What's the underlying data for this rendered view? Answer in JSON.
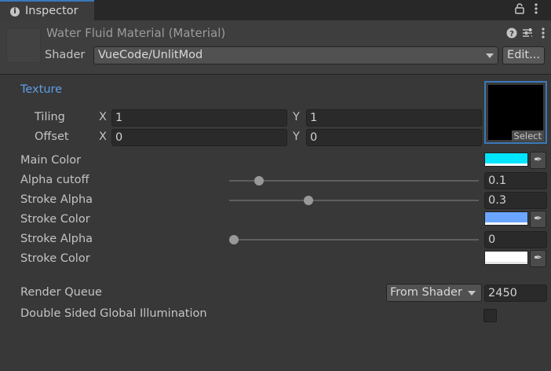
{
  "tab": {
    "icon": "info-icon",
    "label": "Inspector"
  },
  "tab_actions": {
    "lock_icon": "lock-icon",
    "menu_icon": "kebab-menu-icon"
  },
  "header": {
    "title": "Water Fluid Material (Material)",
    "help_icon": "help-icon",
    "settings_icon": "preset-settings-icon",
    "menu_icon": "kebab-menu-icon",
    "shader_label": "Shader",
    "shader_value": "VueCode/UnlitMod",
    "edit_button": "Edit..."
  },
  "texture": {
    "label": "Texture",
    "tiling_label": "Tiling",
    "offset_label": "Offset",
    "x_label": "X",
    "y_label": "Y",
    "tiling_x": "1",
    "tiling_y": "1",
    "offset_x": "0",
    "offset_y": "0",
    "select_label": "Select"
  },
  "properties": {
    "main_color": {
      "label": "Main Color",
      "color": "#00e6ff"
    },
    "alpha_cutoff": {
      "label": "Alpha cutoff",
      "value": "0.1",
      "fraction": 0.1
    },
    "stroke_alpha_1": {
      "label": "Stroke Alpha",
      "value": "0.3",
      "fraction": 0.3
    },
    "stroke_color_1": {
      "label": "Stroke Color",
      "color": "#6aa6ff"
    },
    "stroke_alpha_2": {
      "label": "Stroke Alpha",
      "value": "0",
      "fraction": 0
    },
    "stroke_color_2": {
      "label": "Stroke Color",
      "color": "#ffffff"
    }
  },
  "render_queue": {
    "label": "Render Queue",
    "mode": "From Shader",
    "value": "2450"
  },
  "double_sided_gi": {
    "label": "Double Sided Global Illumination",
    "checked": false
  },
  "colors": {
    "accent": "#3a79bb",
    "section_label": "#5e9ee6",
    "panel": "#383838"
  }
}
